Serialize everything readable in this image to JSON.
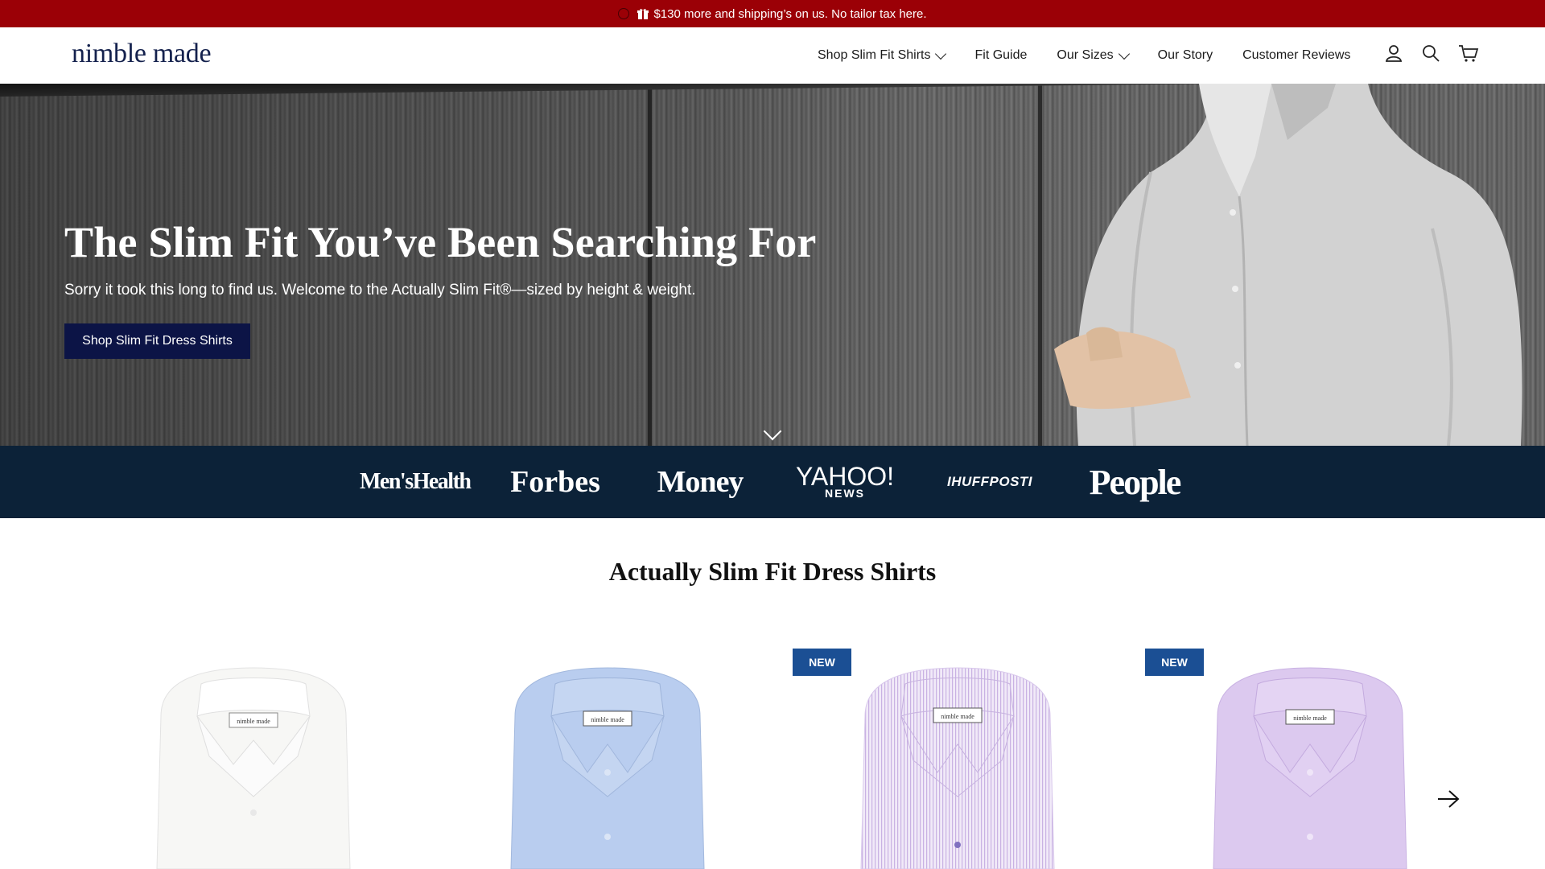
{
  "announcement": {
    "text": "$130 more and shipping’s on us. No tailor tax here.",
    "background": "#9b0006"
  },
  "header": {
    "logo": "nimble made",
    "nav": [
      {
        "label": "Shop Slim Fit Shirts",
        "dropdown": true
      },
      {
        "label": "Fit Guide",
        "dropdown": false
      },
      {
        "label": "Our Sizes",
        "dropdown": true
      },
      {
        "label": "Our Story",
        "dropdown": false
      },
      {
        "label": "Customer Reviews",
        "dropdown": false
      }
    ],
    "icons": [
      "account-icon",
      "search-icon",
      "cart-icon"
    ]
  },
  "hero": {
    "title": "The Slim Fit You’ve Been Searching For",
    "subtitle": "Sorry it took this long to find us. Welcome to the Actually Slim Fit®—sized by height & weight.",
    "cta": "Shop Slim Fit Dress Shirts",
    "cta_color": "#0c1446"
  },
  "press": {
    "background": "#0c2238",
    "logos": [
      "Men'sHealth",
      "Forbes",
      "Money",
      "YAHOO!",
      "NEWS",
      "IHUFFPOSTI",
      "People"
    ]
  },
  "section": {
    "title": "Actually Slim Fit Dress Shirts"
  },
  "products": [
    {
      "badge": "",
      "color": "#f7f7f5",
      "label_text": "nimble made"
    },
    {
      "badge": "",
      "color": "#b9cdef",
      "label_text": "nimble made"
    },
    {
      "badge": "NEW",
      "color": "#e6dcf2",
      "label_text": "nimble made"
    },
    {
      "badge": "NEW",
      "color": "#dcc9ef",
      "label_text": "nimble made"
    }
  ],
  "badge_color": "#1b4f94"
}
